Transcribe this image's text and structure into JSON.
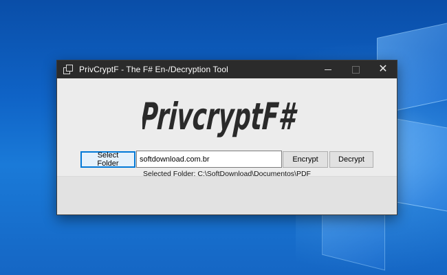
{
  "window": {
    "title": "PrivCryptF - The F# En-/Decryption Tool"
  },
  "logo_text": "PrivcryptF#",
  "controls": {
    "select_folder_label": "Select Folder",
    "password_value": "softdownload.com.br",
    "encrypt_label": "Encrypt",
    "decrypt_label": "Decrypt"
  },
  "status": {
    "selected_folder": "Selected Folder: C:\\SoftDownload\\Documentos\\PDF"
  },
  "icons": {
    "app": "app-window-icon",
    "minimize": "minimize-icon",
    "maximize": "maximize-icon",
    "close": "close-icon"
  }
}
